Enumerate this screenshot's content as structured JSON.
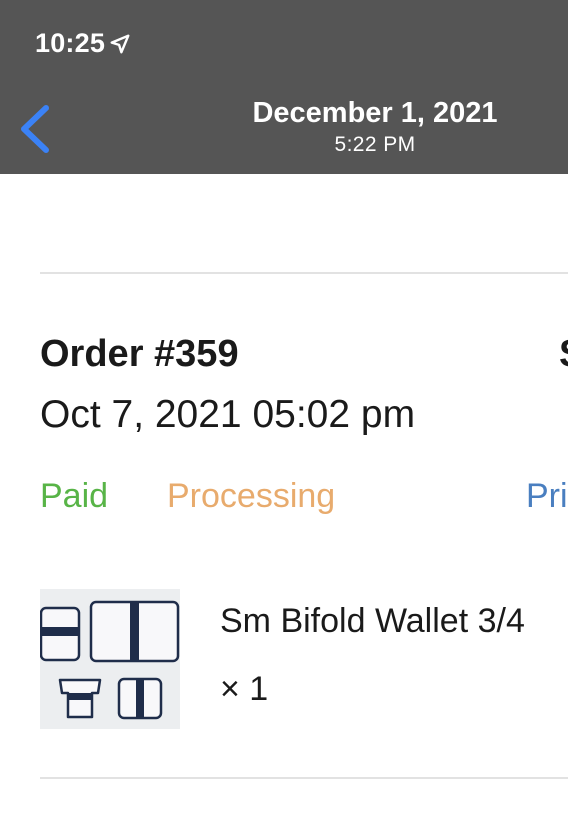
{
  "status_bar": {
    "time": "10:25"
  },
  "nav": {
    "title_date": "December 1, 2021",
    "title_time": "5:22 PM",
    "back_icon": "chevron-left-icon",
    "accent_color": "#3b82f6"
  },
  "order": {
    "number": "Order #359",
    "next_column_partial": "S",
    "date": "Oct 7, 2021 05:02 pm",
    "statuses": {
      "paid": "Paid",
      "processing": "Processing",
      "print_partial": "Pri"
    },
    "status_colors": {
      "paid": "#58b447",
      "processing": "#e8ab6d",
      "print": "#4a7fc0"
    },
    "item": {
      "name": "Sm Bifold Wallet 3/4",
      "quantity": "× 1"
    }
  }
}
